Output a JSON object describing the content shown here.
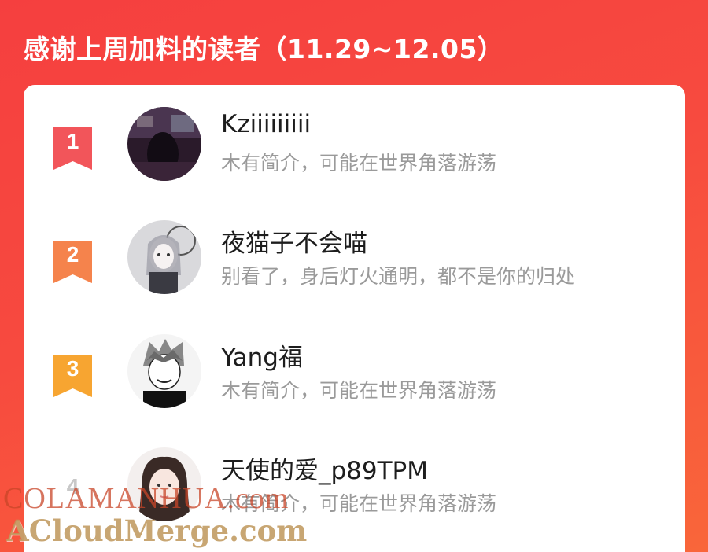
{
  "header": {
    "title": "感谢上周加料的读者（11.29~12.05）"
  },
  "readers": [
    {
      "rank": "1",
      "name": "Kziiiiiiiii",
      "bio": "木有简介，可能在世界角落游荡",
      "badge_color": "#f2555a"
    },
    {
      "rank": "2",
      "name": "夜猫子不会喵",
      "bio": "别看了，身后灯火通明，都不是你的归处",
      "badge_color": "#f5834c"
    },
    {
      "rank": "3",
      "name": "Yang福",
      "bio": "木有简介，可能在世界角落游荡",
      "badge_color": "#f7a531"
    },
    {
      "rank": "4",
      "name": "天使的爱_p89TPM",
      "bio": "木有简介，可能在世界角落游荡",
      "badge_color": "#cccccc"
    }
  ],
  "watermark": {
    "line1": "COLAMANHUA.com",
    "line2": "ACloudMerge.com"
  }
}
